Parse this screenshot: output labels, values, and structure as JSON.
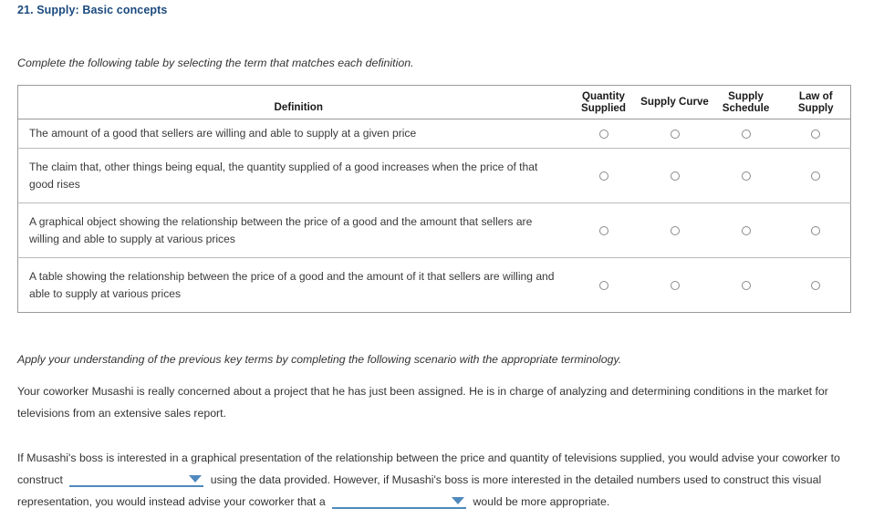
{
  "page": {
    "title": "21. Supply: Basic concepts"
  },
  "instruction": "Complete the following table by selecting the term that matches each definition.",
  "table": {
    "headers": {
      "definition": "Definition",
      "options": [
        "Quantity\nSupplied",
        "Supply\nCurve",
        "Supply\nSchedule",
        "Law of\nSupply"
      ],
      "options_flat": [
        "Quantity Supplied",
        "Supply Curve",
        "Supply Schedule",
        "Law of Supply"
      ]
    },
    "rows": [
      {
        "definition": "The amount of a good that sellers are willing and able to supply at a given price",
        "selected": null
      },
      {
        "definition": "The claim that, other things being equal, the quantity supplied of a good increases when the price of that good rises",
        "selected": null
      },
      {
        "definition": "A graphical object showing the relationship between the price of a good and the amount that sellers are willing and able to supply at various prices",
        "selected": null
      },
      {
        "definition": "A table showing the relationship between the price of a good and the amount of it that sellers are willing and able to supply at various prices",
        "selected": null
      }
    ]
  },
  "apply_line": "Apply your understanding of the previous key terms by completing the following scenario with the appropriate terminology.",
  "scenario_paragraph": "Your coworker Musashi is really concerned about a project that he has just been assigned. He is in charge of analyzing and determining conditions in the market for televisions from an extensive sales report.",
  "advise_paragraph": {
    "part1": "If Musashi's boss is interested in a graphical presentation of the relationship between the price and quantity of televisions supplied, you would advise your coworker to construct",
    "dropdown1_value": "",
    "part2": "using the data provided. However, if Musashi's boss is more interested in the detailed numbers used to construct this visual representation, you would instead advise your coworker that a",
    "dropdown2_value": "",
    "part3": "would be more appropriate."
  },
  "colors": {
    "title": "#1b4a7e",
    "dropdown_accent": "#5089bd",
    "table_border": "#9a9a9a",
    "row_divider": "#b9b9b9",
    "body_text": "#333333"
  }
}
